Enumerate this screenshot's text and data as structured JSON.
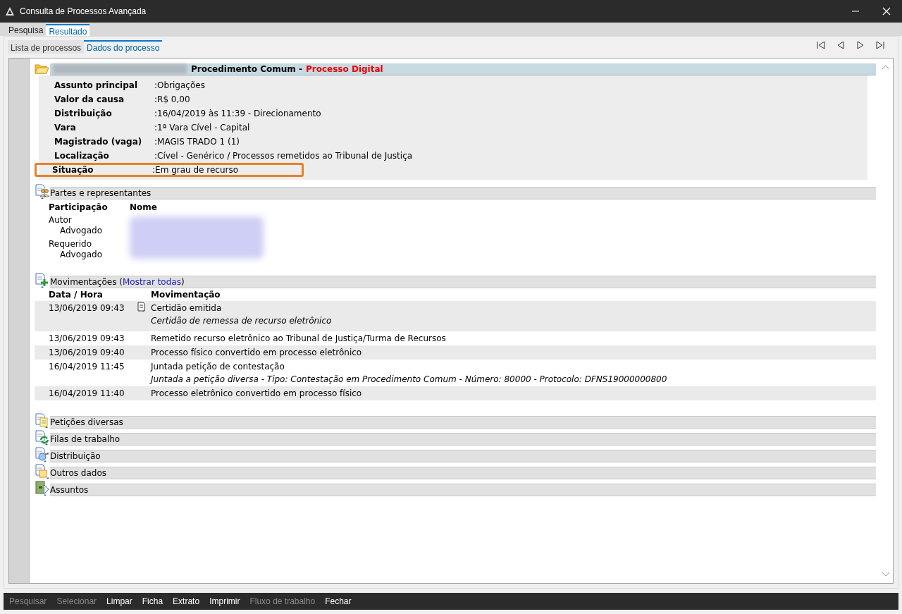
{
  "window": {
    "title": "Consulta de Processos Avançada"
  },
  "tabs": [
    {
      "label": "Pesquisa",
      "selected": false
    },
    {
      "label": "Resultado",
      "selected": true
    }
  ],
  "subtabs": [
    {
      "label": "Lista de processos",
      "selected": false
    },
    {
      "label": "Dados do processo",
      "selected": true
    }
  ],
  "header": {
    "title": "Procedimento Comum -",
    "subtitle": "Processo Digital"
  },
  "details": [
    {
      "label": "Assunto principal",
      "value": ":Obrigações",
      "highlighted": false
    },
    {
      "label": "Valor da causa",
      "value": ":R$ 0,00",
      "highlighted": false
    },
    {
      "label": "Distribuição",
      "value": ":16/04/2019 às 11:39 - Direcionamento",
      "highlighted": false
    },
    {
      "label": "Vara",
      "value": ":1ª Vara Cível - Capital",
      "highlighted": false
    },
    {
      "label": "Magistrado (vaga)",
      "value": ":MAGIS TRADO 1 (1)",
      "highlighted": false
    },
    {
      "label": "Localização",
      "value": ":Cível - Genérico / Processos remetidos ao Tribunal de Justiça",
      "highlighted": false
    },
    {
      "label": "Situação",
      "value": ":Em grau de recurso",
      "highlighted": true
    }
  ],
  "partes": {
    "title": "Partes e representantes",
    "columns": [
      "Participação",
      "Nome"
    ],
    "rows": [
      {
        "role": "Autor",
        "children": [
          {
            "role": "Advogado"
          }
        ]
      },
      {
        "role": "Requerido",
        "children": [
          {
            "role": "Advogado"
          }
        ]
      }
    ]
  },
  "movimentacoes": {
    "title": "Movimentações (",
    "link": "Mostrar todas",
    "title_end": ")",
    "columns": [
      "Data / Hora",
      "Movimentação"
    ],
    "rows": [
      {
        "date": "13/06/2019 09:43",
        "text": "Certidão emitida",
        "detail": "Certidão de remessa de recurso eletrônico",
        "document": true,
        "shaded": true
      },
      {
        "date": "13/06/2019 09:43",
        "text": "Remetido recurso eletrônico ao Tribunal de Justiça/Turma de Recursos",
        "document": false,
        "shaded": false
      },
      {
        "date": "13/06/2019 09:40",
        "text": "Processo físico convertido em processo eletrônico",
        "document": false,
        "shaded": true
      },
      {
        "date": "16/04/2019 11:45",
        "text": "Juntada petição de contestação",
        "detail": "Juntada a petição diversa - Tipo: Contestação em Procedimento Comum - Número: 80000 - Protocolo: DFNS19000000800",
        "document": false,
        "shaded": false
      },
      {
        "date": "16/04/2019 11:40",
        "text": "Processo eletrônico convertido em processo físico",
        "document": false,
        "shaded": true
      }
    ]
  },
  "sections": [
    {
      "title": "Petições diversas",
      "kind": "petitions"
    },
    {
      "title": "Filas de trabalho",
      "kind": "queues"
    },
    {
      "title": "Distribuição",
      "kind": "distribution"
    },
    {
      "title": "Outros dados",
      "kind": "other"
    },
    {
      "title": "Assuntos",
      "kind": "subjects"
    }
  ],
  "footer": [
    {
      "label": "Pesquisar",
      "disabled": true
    },
    {
      "label": "Selecionar",
      "disabled": true
    },
    {
      "label": "Limpar",
      "disabled": false
    },
    {
      "label": "Ficha",
      "disabled": false
    },
    {
      "label": "Extrato",
      "disabled": false
    },
    {
      "label": "Imprimir",
      "disabled": false
    },
    {
      "label": "Fluxo de trabalho",
      "disabled": true
    },
    {
      "label": "Fechar",
      "disabled": false
    }
  ]
}
